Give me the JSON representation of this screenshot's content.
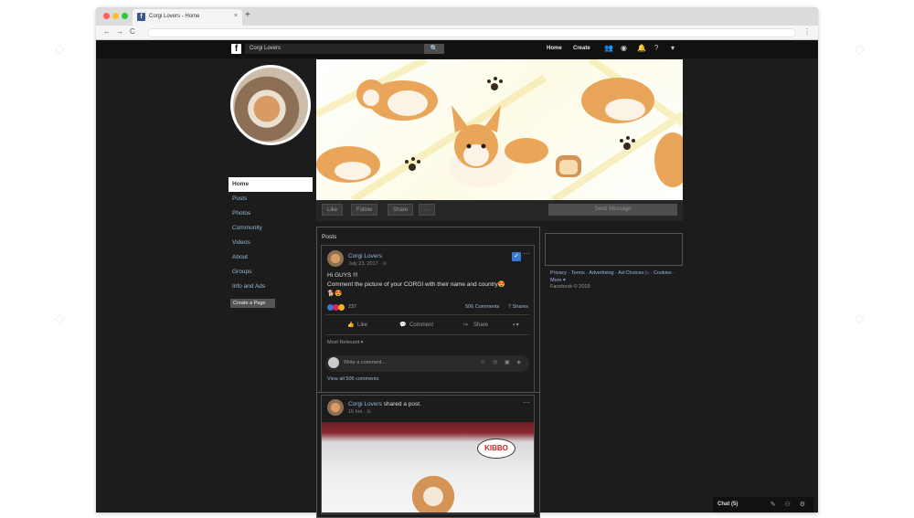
{
  "browser": {
    "tab_title": "Corgi Lovers - Home",
    "tab_close": "×",
    "new_tab": "+",
    "back": "←",
    "forward": "→",
    "reload": "C",
    "menu": "⋮",
    "colors": {
      "close": "#ff5f57",
      "minimize": "#ffbd2e",
      "maximize": "#28c940"
    }
  },
  "navbar": {
    "search_value": "Corgi Lovers",
    "search_button": "🔍",
    "home": "Home",
    "create": "Create",
    "icons": [
      "friends-icon",
      "messenger-icon",
      "notifications-icon",
      "help-icon",
      "dropdown-icon"
    ]
  },
  "sidebar": {
    "items": [
      {
        "label": "Home"
      },
      {
        "label": "Posts"
      },
      {
        "label": "Photos"
      },
      {
        "label": "Community"
      },
      {
        "label": "Videos"
      },
      {
        "label": "About"
      },
      {
        "label": "Groups"
      },
      {
        "label": "Info and Ads"
      }
    ],
    "create_page": "Create a Page"
  },
  "cover_actions": {
    "like": "Like",
    "follow": "Follow",
    "share": "Share",
    "more": "···",
    "send_message": "Send Message"
  },
  "posts": {
    "title": "Posts",
    "post1": {
      "author": "Corgi Lovers",
      "meta": "July 23, 2017 · ⊙",
      "text_line1": "Hi GUYS !!!",
      "text_line2": "Comment the picture of your CORGI with their name and country😍",
      "reactions_count": "237",
      "comments": "506 Comments",
      "shares": "7 Shares",
      "like": "Like",
      "comment": "Comment",
      "share": "Share",
      "most_relevant": "Most Relevant ▾",
      "write_comment": "Write a comment...",
      "view_all": "View all 506 comments"
    },
    "post2": {
      "author": "Corgi Lovers",
      "shared_text": " shared a post.",
      "meta": "16 hrs · ⊙",
      "logo_text": "KIBBO"
    }
  },
  "right_column": {
    "footer_links": "Privacy · Terms · Advertising · Ad Choices ▷ · Cookies · More ▾",
    "copyright": "Facebook © 2019"
  },
  "chat": {
    "label": "Chat (5)"
  }
}
